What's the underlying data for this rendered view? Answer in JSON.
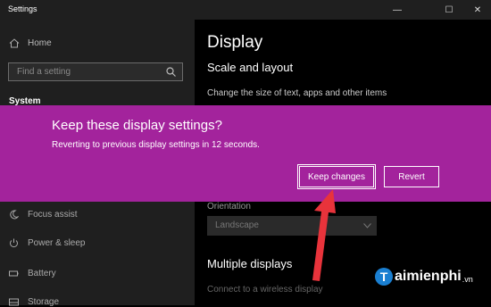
{
  "window": {
    "title": "Settings",
    "minimize_glyph": "—",
    "maximize_glyph": "☐",
    "close_glyph": "✕"
  },
  "sidebar": {
    "home_label": "Home",
    "search_placeholder": "Find a setting",
    "section_label": "System",
    "items": [
      {
        "label": "Focus assist",
        "icon": "moon-icon"
      },
      {
        "label": "Power & sleep",
        "icon": "power-icon"
      },
      {
        "label": "Battery",
        "icon": "battery-icon"
      },
      {
        "label": "Storage",
        "icon": "storage-icon"
      }
    ]
  },
  "main": {
    "page_title": "Display",
    "scale_heading": "Scale and layout",
    "scale_description": "Change the size of text, apps and other items",
    "orientation_label": "Orientation",
    "orientation_value": "Landscape",
    "multiple_displays_heading": "Multiple displays",
    "connect_link": "Connect to a wireless display"
  },
  "dialog": {
    "title": "Keep these display settings?",
    "message": "Reverting to previous display settings in 12 seconds.",
    "keep_label": "Keep changes",
    "revert_label": "Revert"
  },
  "watermark": {
    "letter": "T",
    "text": "aimienphi",
    "suffix": ".vn"
  },
  "colors": {
    "dialog_bg": "#a3239c",
    "arrow": "#e8333b",
    "sidebar_bg": "#1f1f1f"
  }
}
